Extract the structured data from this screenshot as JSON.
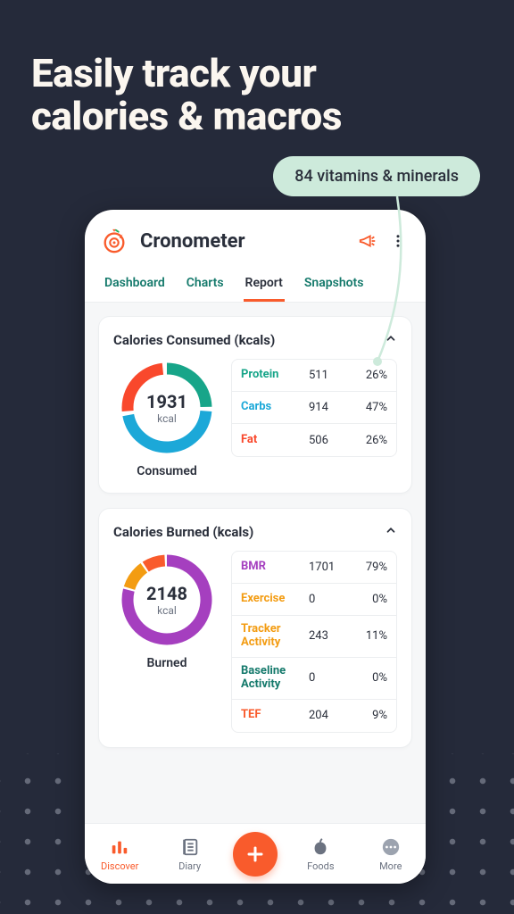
{
  "headline_line1": "Easily track your",
  "headline_line2": "calories & macros",
  "badge": "84 vitamins & minerals",
  "app_name": "Cronometer",
  "tabs": {
    "dashboard": "Dashboard",
    "charts": "Charts",
    "report": "Report",
    "snapshots": "Snapshots"
  },
  "colors": {
    "protein": "#17a589",
    "carbs": "#1ca8d8",
    "fat": "#f9482c",
    "bmr": "#a53fbf",
    "exercise": "#f39c12",
    "tracker": "#f39c12",
    "baseline": "#14796b",
    "tef": "#f95b2c"
  },
  "consumed": {
    "title": "Calories Consumed (kcals)",
    "donut_label": "Consumed",
    "value": "1931",
    "unit": "kcal",
    "rows": [
      {
        "label": "Protein",
        "val": "511",
        "pct": "26%",
        "color": "protein"
      },
      {
        "label": "Carbs",
        "val": "914",
        "pct": "47%",
        "color": "carbs"
      },
      {
        "label": "Fat",
        "val": "506",
        "pct": "26%",
        "color": "fat"
      }
    ]
  },
  "burned": {
    "title": "Calories Burned (kcals)",
    "donut_label": "Burned",
    "value": "2148",
    "unit": "kcal",
    "rows": [
      {
        "label": "BMR",
        "val": "1701",
        "pct": "79%",
        "color": "bmr"
      },
      {
        "label": "Exercise",
        "val": "0",
        "pct": "0%",
        "color": "exercise"
      },
      {
        "label": "Tracker Activity",
        "val": "243",
        "pct": "11%",
        "color": "tracker"
      },
      {
        "label": "Baseline Activity",
        "val": "0",
        "pct": "0%",
        "color": "baseline"
      },
      {
        "label": "TEF",
        "val": "204",
        "pct": "9%",
        "color": "tef"
      }
    ]
  },
  "nav": {
    "discover": "Discover",
    "diary": "Diary",
    "foods": "Foods",
    "more": "More"
  },
  "chart_data": [
    {
      "type": "pie",
      "title": "Calories Consumed (kcals)",
      "total": 1931,
      "unit": "kcal",
      "series": [
        {
          "name": "Protein",
          "value": 511,
          "percent": 26
        },
        {
          "name": "Carbs",
          "value": 914,
          "percent": 47
        },
        {
          "name": "Fat",
          "value": 506,
          "percent": 26
        }
      ]
    },
    {
      "type": "pie",
      "title": "Calories Burned (kcals)",
      "total": 2148,
      "unit": "kcal",
      "series": [
        {
          "name": "BMR",
          "value": 1701,
          "percent": 79
        },
        {
          "name": "Exercise",
          "value": 0,
          "percent": 0
        },
        {
          "name": "Tracker Activity",
          "value": 243,
          "percent": 11
        },
        {
          "name": "Baseline Activity",
          "value": 0,
          "percent": 0
        },
        {
          "name": "TEF",
          "value": 204,
          "percent": 9
        }
      ]
    }
  ]
}
